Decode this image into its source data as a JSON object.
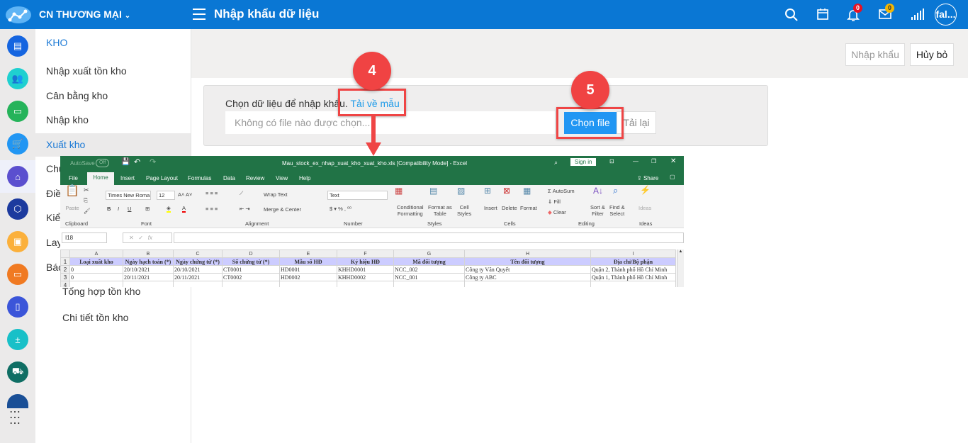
{
  "header": {
    "org": "CN THƯƠNG MẠI",
    "title": "Nhập khẩu dữ liệu",
    "notif_count": "0",
    "mail_count": "0",
    "user": "fal..."
  },
  "colors": {
    "primary": "#0a77d4",
    "accent_button": "#2196f3",
    "annotation": "#ef4545",
    "excel_green": "#217346"
  },
  "rail_icons": [
    "warehouse-icon",
    "people-icon",
    "laptop-icon",
    "cart-icon",
    "bank-icon",
    "box-icon",
    "package-icon",
    "id-card-icon",
    "document-icon",
    "calculator-icon",
    "truck-icon",
    "ledger-icon",
    "apps-grid-icon"
  ],
  "submenu": {
    "title": "KHO",
    "items": [
      "Nhập xuất tồn kho",
      "Cân bằng kho",
      "Nhập kho",
      "Xuất kho",
      "Chu",
      "Điề",
      "Kiể",
      "Lay",
      "Báo"
    ],
    "selected": "Xuất kho",
    "sub_items": [
      "Tổng hợp tồn kho",
      "Chi tiết tồn kho"
    ]
  },
  "actions": {
    "import": "Nhập khẩu",
    "cancel": "Hủy bỏ"
  },
  "import_card": {
    "label": "Chọn dữ liệu để nhập khẩu.",
    "template_link": "Tải về mẫu",
    "file_placeholder": "Không có file nào được chọn...",
    "choose_file": "Chọn file",
    "reload": "Tải lại"
  },
  "annotations": [
    "4",
    "5"
  ],
  "excel": {
    "autosave": "AutoSave",
    "autosave_state": "Off",
    "title": "Mau_stock_ex_nhap_xuat_kho_xuat_kho.xls  [Compatibility Mode]  -  Excel",
    "sign_in": "Sign in",
    "share": "Share",
    "tabs": [
      "File",
      "Home",
      "Insert",
      "Page Layout",
      "Formulas",
      "Data",
      "Review",
      "View",
      "Help"
    ],
    "font_name": "Times New Roma",
    "font_size": "12",
    "number_format": "Text",
    "ribbon": {
      "paste": "Paste",
      "wrap": "Wrap Text",
      "merge": "Merge & Center",
      "cond1": "Conditional",
      "cond2": "Formatting",
      "fmt1": "Format as",
      "fmt2": "Table",
      "cell1": "Cell",
      "cell2": "Styles",
      "insert": "Insert",
      "delete": "Delete",
      "format": "Format",
      "autosum": "AutoSum",
      "fill": "Fill",
      "clear": "Clear",
      "sort1": "Sort &",
      "sort2": "Filter",
      "find1": "Find &",
      "find2": "Select",
      "ideas": "Ideas"
    },
    "groups": [
      "Clipboard",
      "Font",
      "Alignment",
      "Number",
      "Styles",
      "Cells",
      "Editing",
      "Ideas"
    ],
    "name_box": "I18",
    "columns": [
      "A",
      "B",
      "C",
      "D",
      "E",
      "F",
      "G",
      "H",
      "I"
    ],
    "headers": [
      "Loại xuất kho",
      "Ngày hạch toán (*)",
      "Ngày chứng từ (*)",
      "Số chứng từ (*)",
      "Mẫu số HĐ",
      "Ký hiệu HĐ",
      "Mã đối tượng",
      "Tên đối tượng",
      "Địa chỉ/Bộ phận"
    ],
    "rows": [
      [
        "0",
        "20/10/2021",
        "20/10/2021",
        "CT0001",
        "HD0001",
        "KHHD0001",
        "NCC_002",
        "Công ty Văn Quyết",
        "Quận 2, Thành phố Hồ Chí Minh"
      ],
      [
        "0",
        "20/11/2021",
        "20/11/2021",
        "CT0002",
        "HD0002",
        "KHHD0002",
        "NCC_001",
        "Công ty ABC",
        "Quận 1, Thành phố Hồ Chí Minh"
      ]
    ]
  }
}
